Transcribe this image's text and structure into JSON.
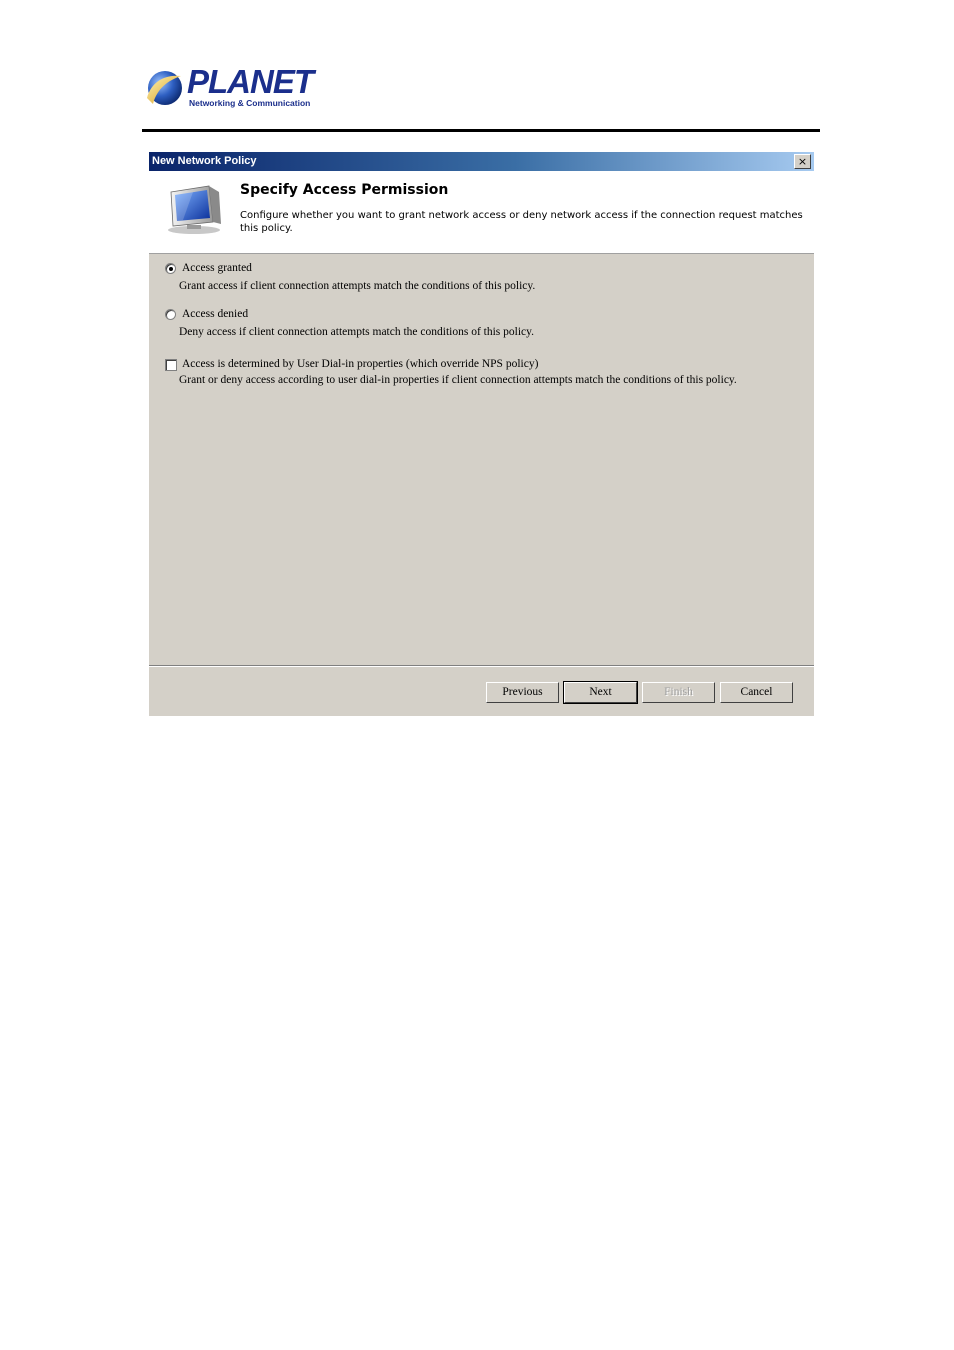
{
  "document": {
    "logo_name": "PLANET",
    "logo_tagline": "Networking & Communication"
  },
  "dialog": {
    "title": "New Network Policy",
    "close_glyph": "×",
    "header": {
      "title": "Specify Access Permission",
      "description": "Configure whether you want to grant network access or deny network access if the connection request matches this policy.",
      "icon": "computer-monitor-icon"
    },
    "options": [
      {
        "type": "radio",
        "label": "Access granted",
        "description": "Grant access if client connection attempts match the conditions of this policy.",
        "checked": true
      },
      {
        "type": "radio",
        "label": "Access denied",
        "description": "Deny access if client connection attempts match the conditions of this policy.",
        "checked": false
      },
      {
        "type": "checkbox",
        "label": "Access is determined by User Dial-in properties (which override NPS policy)",
        "description": "Grant or deny access according to user dial-in properties if client connection attempts match the conditions of this policy.",
        "checked": false
      }
    ],
    "buttons": {
      "previous": "Previous",
      "next": "Next",
      "finish": "Finish",
      "cancel": "Cancel"
    }
  }
}
